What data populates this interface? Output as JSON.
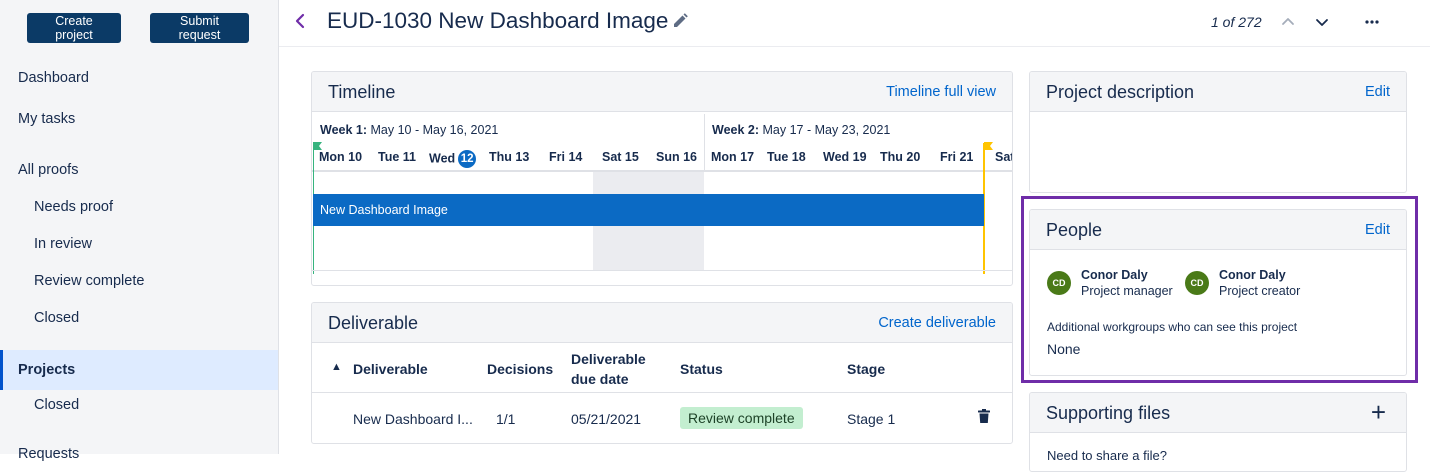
{
  "sidebar": {
    "create_project": "Create project",
    "submit_request": "Submit request",
    "items": [
      {
        "label": "Dashboard"
      },
      {
        "label": "My tasks"
      },
      {
        "label": "All proofs"
      },
      {
        "label": "Needs proof"
      },
      {
        "label": "In review"
      },
      {
        "label": "Review complete"
      },
      {
        "label": "Closed"
      },
      {
        "label": "Projects"
      },
      {
        "label": "Closed"
      },
      {
        "label": "Requests"
      }
    ],
    "active_item": "Projects"
  },
  "header": {
    "title": "EUD-1030 New Dashboard Image",
    "pager": "1 of 272",
    "icons": [
      "chevron-left-icon",
      "pencil-icon",
      "chevron-up-icon",
      "chevron-down-icon",
      "more-icon"
    ]
  },
  "timeline": {
    "title": "Timeline",
    "link": "Timeline full view",
    "week1_label": "Week 1:",
    "week1_range": "May 10 - May 16, 2021",
    "week2_label": "Week 2:",
    "week2_range": "May 17 - May 23, 2021",
    "days": [
      "Mon 10",
      "Tue 11",
      "Wed",
      "Thu 13",
      "Fri 14",
      "Sat 15",
      "Sun 16",
      "Mon 17",
      "Tue 18",
      "Wed 19",
      "Thu 20",
      "Fri 21",
      "Sat"
    ],
    "today": "12",
    "bar_label": "New Dashboard Image",
    "colors": {
      "bar": "#0b6ac4",
      "start_flag": "#36b37e",
      "end_flag": "#ffc400"
    }
  },
  "deliverable": {
    "title": "Deliverable",
    "link": "Create deliverable",
    "sort_indicator": "▲",
    "columns": [
      "Deliverable",
      "Decisions",
      "Deliverable",
      "due date",
      "Status",
      "Stage"
    ],
    "row": {
      "name": "New Dashboard I...",
      "decisions": "1/1",
      "due_date": "05/21/2021",
      "status": "Review complete",
      "stage": "Stage 1"
    }
  },
  "description": {
    "title": "Project description",
    "edit": "Edit"
  },
  "people": {
    "title": "People",
    "edit": "Edit",
    "persons": [
      {
        "initials": "CD",
        "name": "Conor Daly",
        "role": "Project manager"
      },
      {
        "initials": "CD",
        "name": "Conor Daly",
        "role": "Project creator"
      }
    ],
    "workgroups_label": "Additional workgroups who can see this project",
    "workgroups_value": "None",
    "highlight_color": "#6f2da8"
  },
  "supporting": {
    "title": "Supporting files",
    "add": "+",
    "partial_text": "Need to share a file?"
  }
}
